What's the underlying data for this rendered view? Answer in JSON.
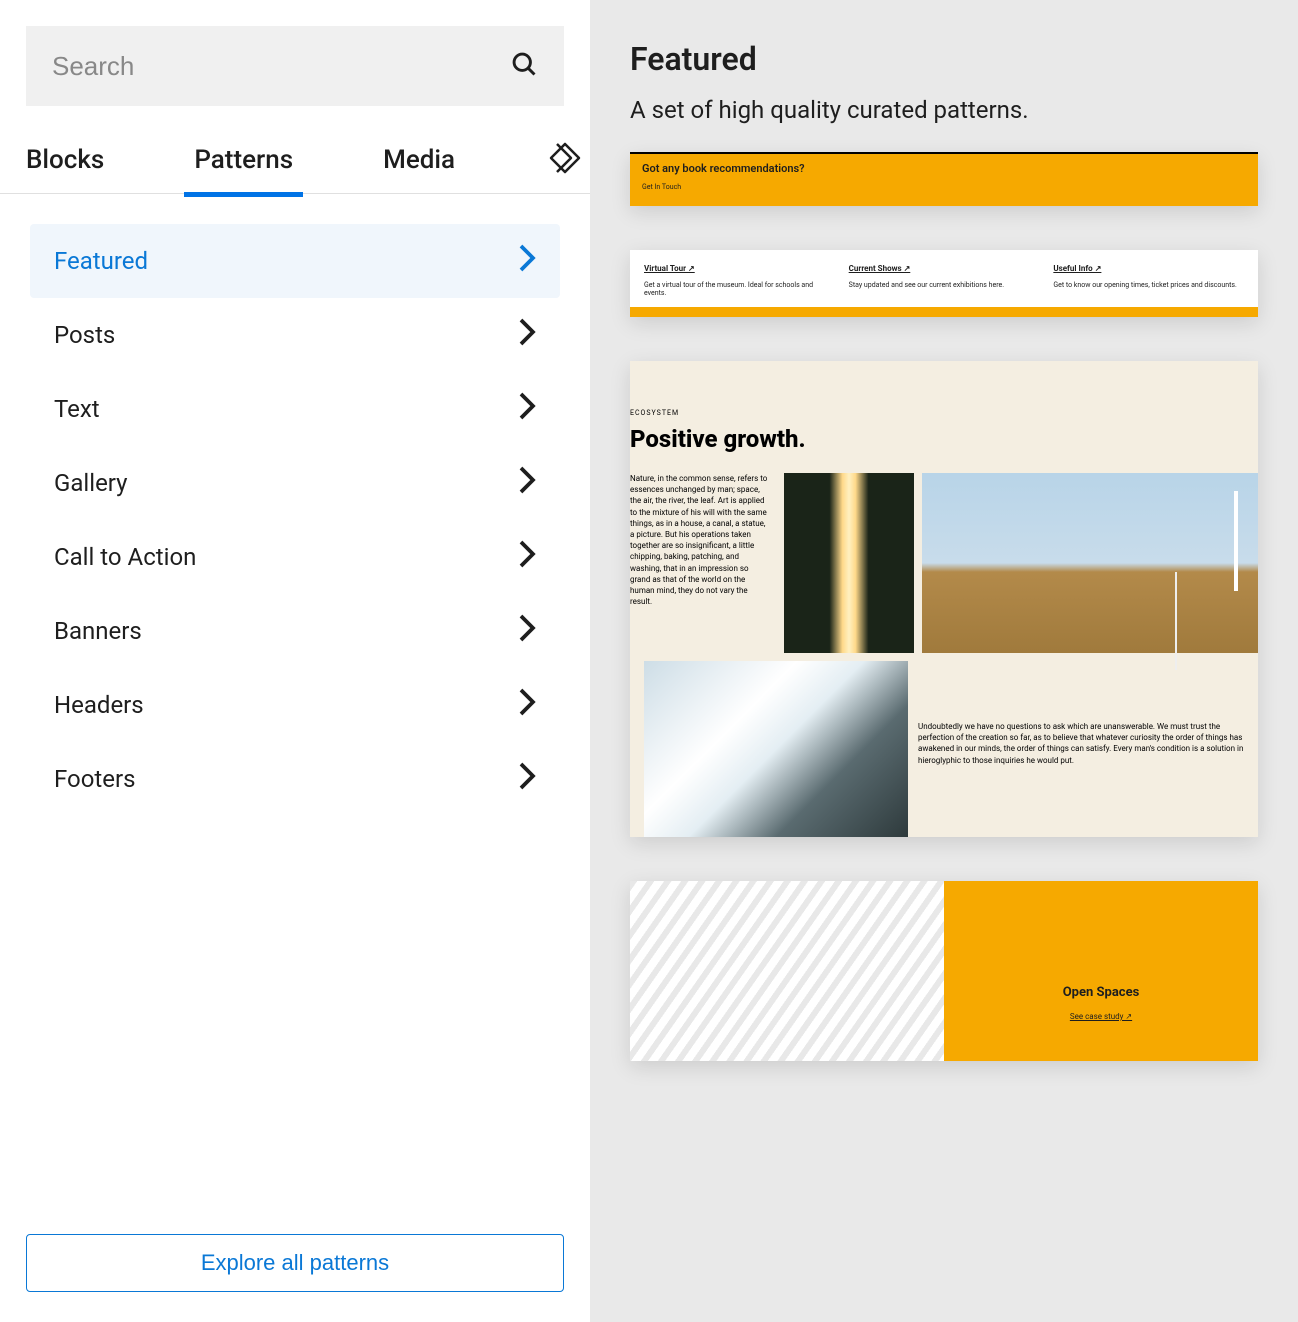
{
  "search": {
    "placeholder": "Search"
  },
  "tabs": {
    "blocks": "Blocks",
    "patterns": "Patterns",
    "media": "Media"
  },
  "categories": [
    {
      "label": "Featured",
      "selected": true
    },
    {
      "label": "Posts"
    },
    {
      "label": "Text"
    },
    {
      "label": "Gallery"
    },
    {
      "label": "Call to Action"
    },
    {
      "label": "Banners"
    },
    {
      "label": "Headers"
    },
    {
      "label": "Footers"
    }
  ],
  "explore_button": "Explore all patterns",
  "right": {
    "title": "Featured",
    "subtitle": "A set of high quality curated patterns."
  },
  "pv1": {
    "heading": "Got any book recommendations?",
    "sub": "Get In Touch"
  },
  "pv2": {
    "col1_h": "Virtual Tour ↗",
    "col1_t": "Get a virtual tour of the museum. Ideal for schools and events.",
    "col2_h": "Current Shows ↗",
    "col2_t": "Stay updated and see our current exhibitions here.",
    "col3_h": "Useful Info ↗",
    "col3_t": "Get to know our opening times, ticket prices and discounts."
  },
  "pv3": {
    "eyebrow": "ECOSYSTEM",
    "title": "Positive growth.",
    "text1": "Nature, in the common sense, refers to essences unchanged by man; space, the air, the river, the leaf. Art is applied to the mixture of his will with the same things, as in a house, a canal, a statue, a picture. But his operations taken together are so insignificant, a little chipping, baking, patching, and washing, that in an impression so grand as that of the world on the human mind, they do not vary the result.",
    "text2": "Undoubtedly we have no questions to ask which are unanswerable. We must trust the perfection of the creation so far, as to believe that whatever curiosity the order of things has awakened in our minds, the order of things can satisfy. Every man's condition is a solution in hieroglyphic to those inquiries he would put."
  },
  "pv4": {
    "title": "Open Spaces",
    "link": "See case study ↗"
  }
}
